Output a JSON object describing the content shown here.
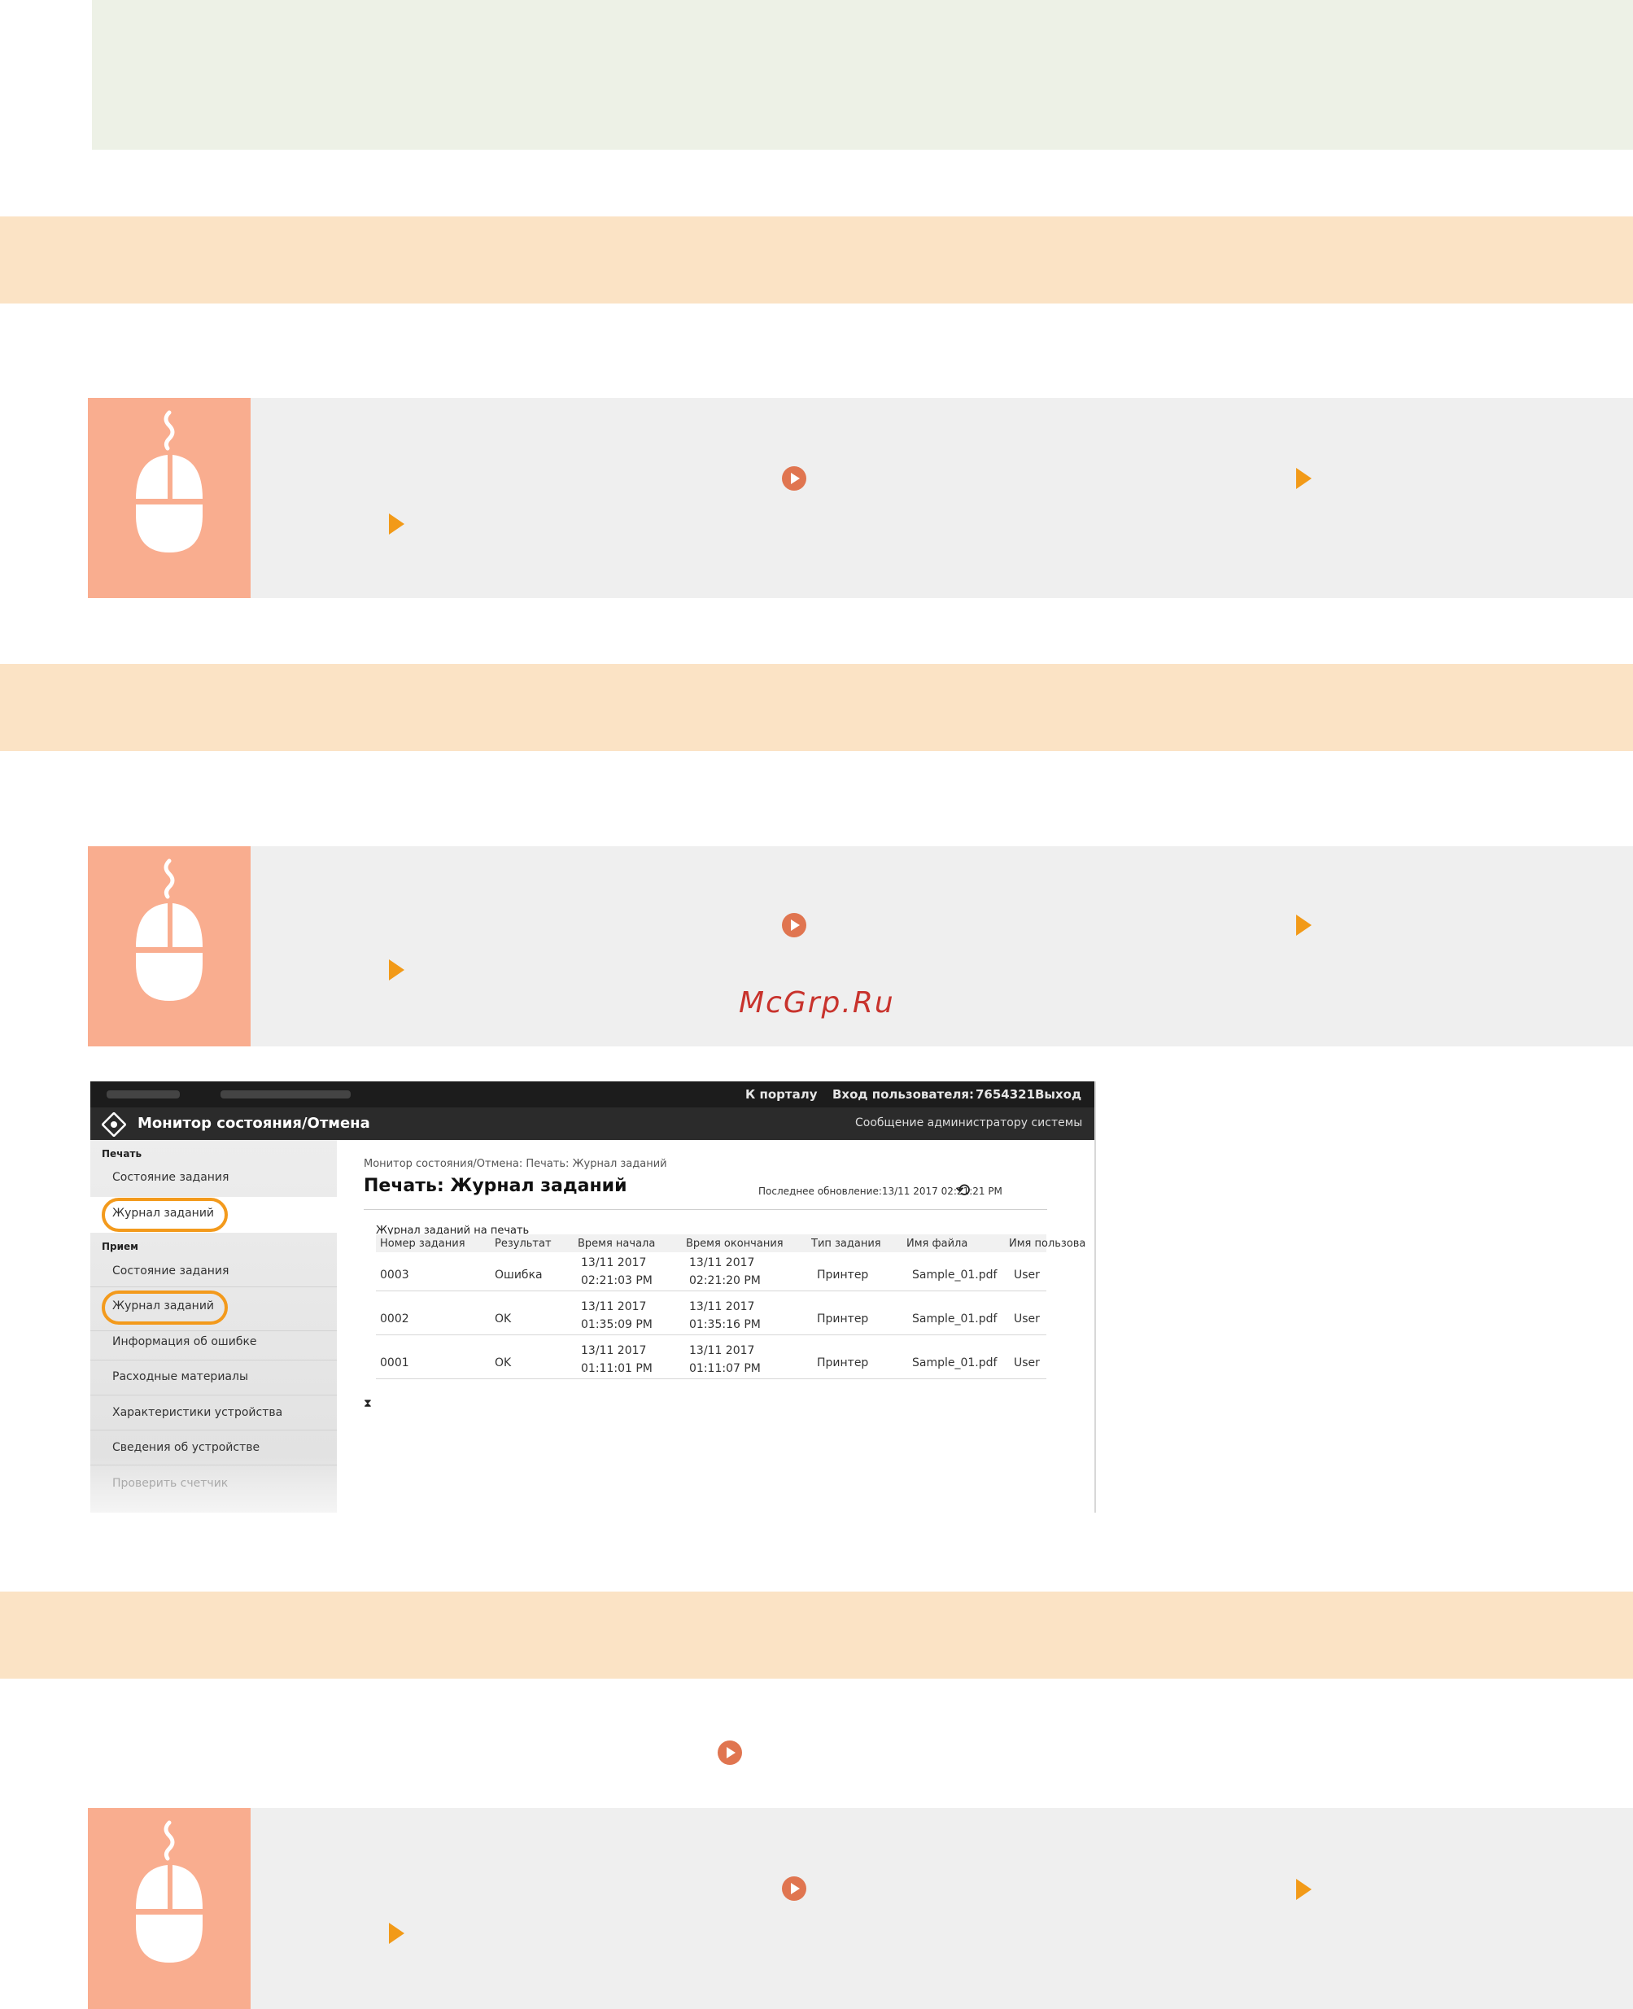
{
  "watermark": "McGrp.Ru",
  "icons": {
    "mouse": "mouse-icon",
    "link": "circle-arrow-link-icon",
    "menu_arrow": "orange-triangle-icon"
  },
  "colors": {
    "heading_band": "#fbe3c5",
    "mouse_tile": "#f9ad8f",
    "panel": "#efefef",
    "note_box": "#edf1e6",
    "link_circle": "#e07550",
    "arrow": "#f29a18",
    "highlight_oval": "#f39a1c"
  },
  "screenshot": {
    "top_right": {
      "portal": "К порталу",
      "login_label": "Вход пользователя:",
      "user_id": "7654321",
      "logout": "Выход"
    },
    "app_title": "Монитор состояния/Отмена",
    "admin_message": "Сообщение администратору системы",
    "sidebar": {
      "group_print": "Печать",
      "print_items": [
        "Состояние задания",
        "Журнал заданий"
      ],
      "group_receive": "Прием",
      "receive_items": [
        "Состояние задания",
        "Журнал заданий"
      ],
      "other_items": [
        "Информация об ошибке",
        "Расходные материалы",
        "Характеристики устройства",
        "Сведения об устройстве",
        "Проверить счетчик"
      ]
    },
    "breadcrumb": "Монитор состояния/Отмена: Печать: Журнал заданий",
    "page_title": "Печать: Журнал заданий",
    "last_update": "Последнее обновление:13/11 2017 02:21:21 PM",
    "table_title": "Журнал заданий на печать",
    "columns": [
      "Номер задания",
      "Результат",
      "Время начала",
      "Время окончания",
      "Тип задания",
      "Имя файла",
      "Имя пользова"
    ],
    "rows": [
      {
        "id": "0003",
        "result": "Ошибка",
        "start": "13/11 2017\n02:21:03 PM",
        "end": "13/11 2017\n02:21:20 PM",
        "type": "Принтер",
        "file": "Sample_01.pdf",
        "user": "User"
      },
      {
        "id": "0002",
        "result": "OK",
        "start": "13/11 2017\n01:35:09 PM",
        "end": "13/11 2017\n01:35:16 PM",
        "type": "Принтер",
        "file": "Sample_01.pdf",
        "user": "User"
      },
      {
        "id": "0001",
        "result": "OK",
        "start": "13/11 2017\n01:11:01 PM",
        "end": "13/11 2017\n01:11:07 PM",
        "type": "Принтер",
        "file": "Sample_01.pdf",
        "user": "User"
      }
    ]
  }
}
